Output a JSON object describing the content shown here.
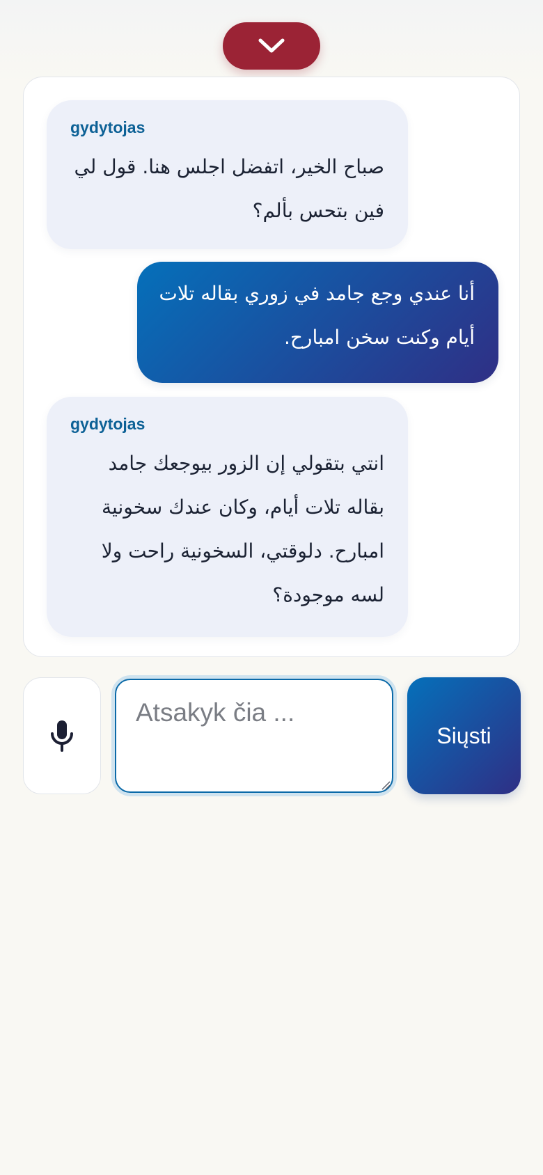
{
  "header": {
    "collapse_icon": "chevron-down-icon",
    "accent_color": "#9b2335"
  },
  "conversation": {
    "messages": [
      {
        "role": "doctor",
        "sender": "gydytojas",
        "text": "صباح الخير، اتفضل اجلس هنا. قول لي فين بتحس بألم؟"
      },
      {
        "role": "patient",
        "text": "أنا عندي وجع جامد في زوري بقاله تلات أيام وكنت سخن امبارح."
      },
      {
        "role": "doctor",
        "sender": "gydytojas",
        "text": "انتي بتقولي إن الزور بيوجعك جامد بقاله تلات أيام، وكان عندك سخونية امبارح. دلوقتي، السخونية راحت ولا لسه موجودة؟"
      }
    ]
  },
  "composer": {
    "mic_icon": "microphone-icon",
    "input_value": "",
    "input_placeholder": "Atsakyk čia ...",
    "send_label": "Siųsti",
    "brand_gradient": [
      "#0570ba",
      "#2f2f85"
    ]
  }
}
